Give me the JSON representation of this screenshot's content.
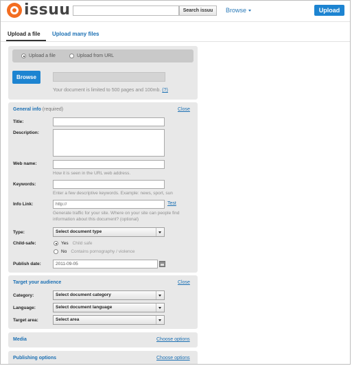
{
  "header": {
    "logo_text": "issuu",
    "search_placeholder": "",
    "search_button": "Search issuu",
    "browse_menu": "Browse",
    "upload_button": "Upload"
  },
  "tabs": {
    "active": "Upload a file",
    "other": "Upload many files"
  },
  "upload_source": {
    "options": [
      "Upload a file",
      "Upload from URL"
    ],
    "selected": "Upload a file",
    "browse_button": "Browse",
    "limit_note": "Your document is limited to 500 pages and 100mb.",
    "limit_help": "(?)"
  },
  "general_info": {
    "title": "General info",
    "required_note": "(required)",
    "close_link": "Close",
    "fields": {
      "title_label": "Title:",
      "description_label": "Description:",
      "webname_label": "Web name:",
      "webname_help": "How it is seen in the URL web address.",
      "keywords_label": "Keywords:",
      "keywords_help": "Enter a few descriptive keywords. Example: news, sport, sun",
      "infolink_label": "Info Link:",
      "infolink_value": "http://",
      "infolink_test": "Test",
      "infolink_help": "Generate traffic for your site. Where on your site can people find information about this document? (optional)",
      "type_label": "Type:",
      "type_select": "Select document type",
      "childsafe_label": "Child-safe:",
      "childsafe_yes": "Yes",
      "childsafe_yes_desc": "Child safe",
      "childsafe_no": "No",
      "childsafe_no_desc": "Contains pornography / violence",
      "childsafe_selected": "Yes",
      "publish_label": "Publish date:",
      "publish_value": "2011-09-05"
    }
  },
  "audience": {
    "title": "Target your audience",
    "close_link": "Close",
    "category_label": "Category:",
    "category_select": "Select document category",
    "language_label": "Language:",
    "language_select": "Select document language",
    "area_label": "Target area:",
    "area_select": "Select area"
  },
  "media": {
    "title": "Media",
    "link": "Choose options"
  },
  "publishing": {
    "title": "Publishing options",
    "link": "Choose options"
  }
}
